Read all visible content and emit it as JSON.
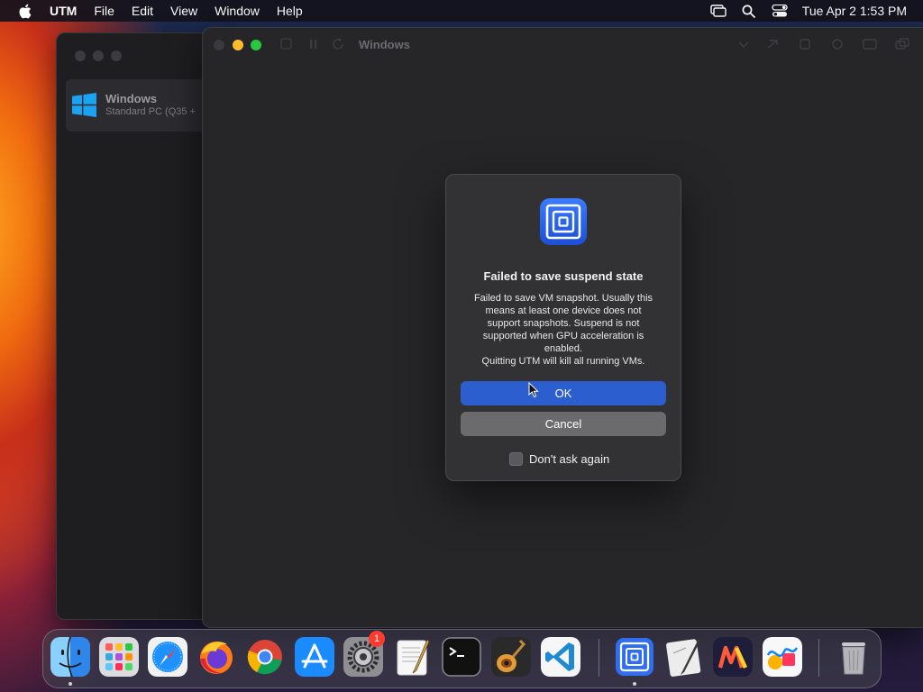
{
  "menubar": {
    "app_name": "UTM",
    "items": [
      "File",
      "Edit",
      "View",
      "Window",
      "Help"
    ],
    "clock": "Tue Apr 2  1:53 PM",
    "status_icons": [
      "screen-mirroring-icon",
      "spotlight-search-icon",
      "control-center-icon"
    ]
  },
  "library": {
    "vm": {
      "name": "Windows",
      "subtitle": "Standard PC (Q35 +"
    }
  },
  "vm_window": {
    "title": "Windows"
  },
  "dialog": {
    "title": "Failed to save suspend state",
    "message_lines": [
      "Failed to save VM snapshot. Usually this",
      "means at least one device does not",
      "support snapshots. Suspend is not",
      "supported when GPU acceleration is",
      "enabled.",
      "Quitting UTM will kill all running VMs."
    ],
    "ok_label": "OK",
    "cancel_label": "Cancel",
    "checkbox_label": "Don't ask again",
    "checkbox_checked": false
  },
  "dock": {
    "apps": [
      "Finder",
      "Launchpad",
      "Safari",
      "Firefox",
      "Chrome",
      "App Store",
      "System Settings",
      "TextEdit",
      "Terminal",
      "GarageBand",
      "Visual Studio Code",
      "UTM",
      "Script Editor",
      "Miro",
      "Freeform",
      "Trash"
    ],
    "settings_badge": "1"
  },
  "colors": {
    "accent": "#2c5ecf",
    "utm_blue": "#2f6ef0",
    "windows_blue": "#1aa3f0"
  }
}
